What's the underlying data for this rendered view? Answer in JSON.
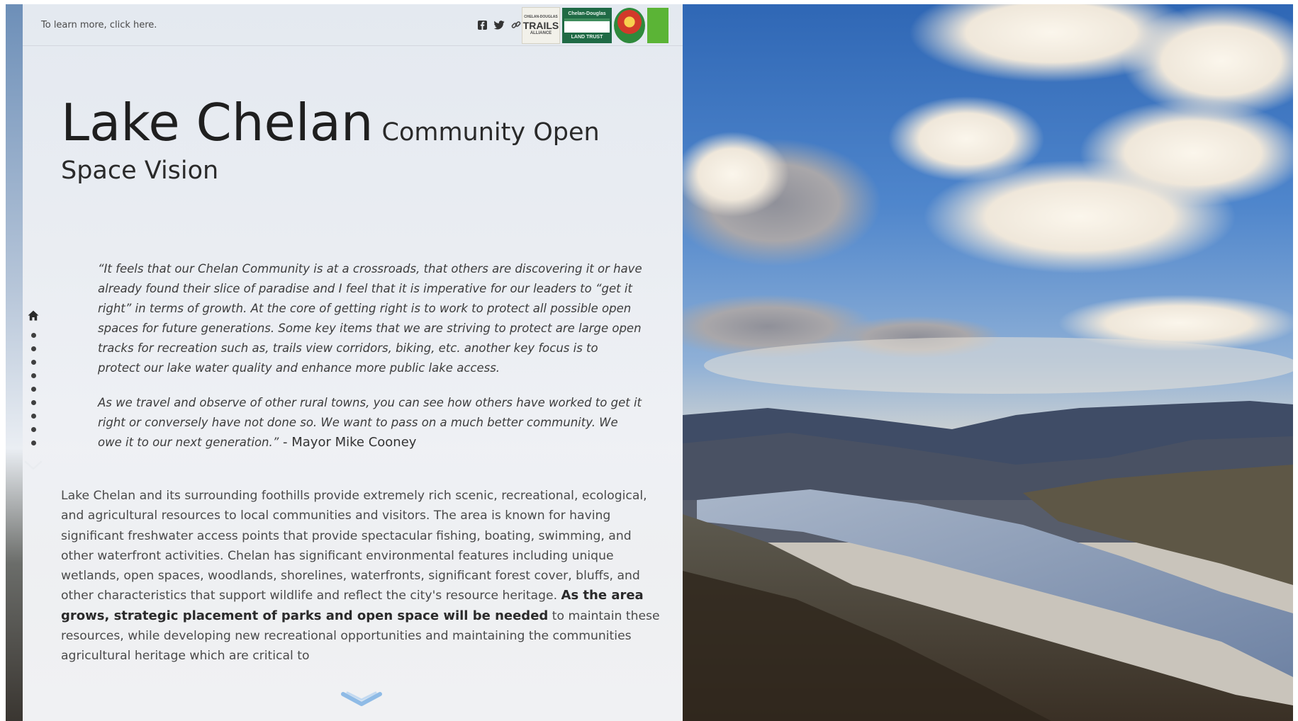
{
  "header": {
    "learn_more": "To learn more, click here.",
    "share_icons": [
      "facebook-icon",
      "twitter-icon",
      "link-icon"
    ]
  },
  "partners": {
    "trails_line1": "CHELAN-DOUGLAS",
    "trails_big": "TRAILS",
    "trails_line3": "ALLIANCE",
    "land_top": "Chelan-Douglas",
    "land_bottom": "LAND TRUST"
  },
  "title": {
    "main": "Lake Chelan",
    "sub": "Community Open",
    "line2": "Space Vision"
  },
  "quote": {
    "paragraph1": "“It feels that our Chelan Community is at a crossroads, that others are discovering it or have already found their slice of paradise and I feel that it is imperative for our leaders to “get it right” in terms of growth. At the core of getting right is to work to protect all possible open spaces for future generations. Some key items that we are striving to protect are large open tracks for recreation such as, trails view corridors, biking, etc. another key focus is to protect our lake water quality and enhance more public lake access.",
    "paragraph2": "As we travel and observe of other rural towns, you can see how others have worked to get it right or conversely have not done so. We want to pass on a much better community. We owe it to our next generation.”",
    "attribution": " - Mayor Mike Cooney"
  },
  "body": {
    "intro": "Lake Chelan and its surrounding foothills provide extremely rich scenic, recreational, ecological, and agricultural resources to local communities and visitors. The area is known for having significant freshwater access points that provide spectacular fishing, boating, swimming, and other waterfront activities. Chelan has significant environmental features including unique wetlands, open spaces, woodlands, shorelines, waterfronts, significant forest cover, bluffs, and other characteristics that support wildlife and reflect the city's resource heritage. ",
    "bold": "As the area grows, strategic placement of parks and open space will be needed",
    "rest": " to maintain these resources, while developing new recreational opportunities and maintaining the communities agricultural heritage which are critical to"
  },
  "navigation": {
    "dot_count": 9,
    "home_icon": "home-icon",
    "down_icon": "chevron-down-icon"
  },
  "colors": {
    "panel_bg": "#eceff3",
    "title_text": "#1f1f1f",
    "accent_chevron": "#6fa6dd"
  }
}
